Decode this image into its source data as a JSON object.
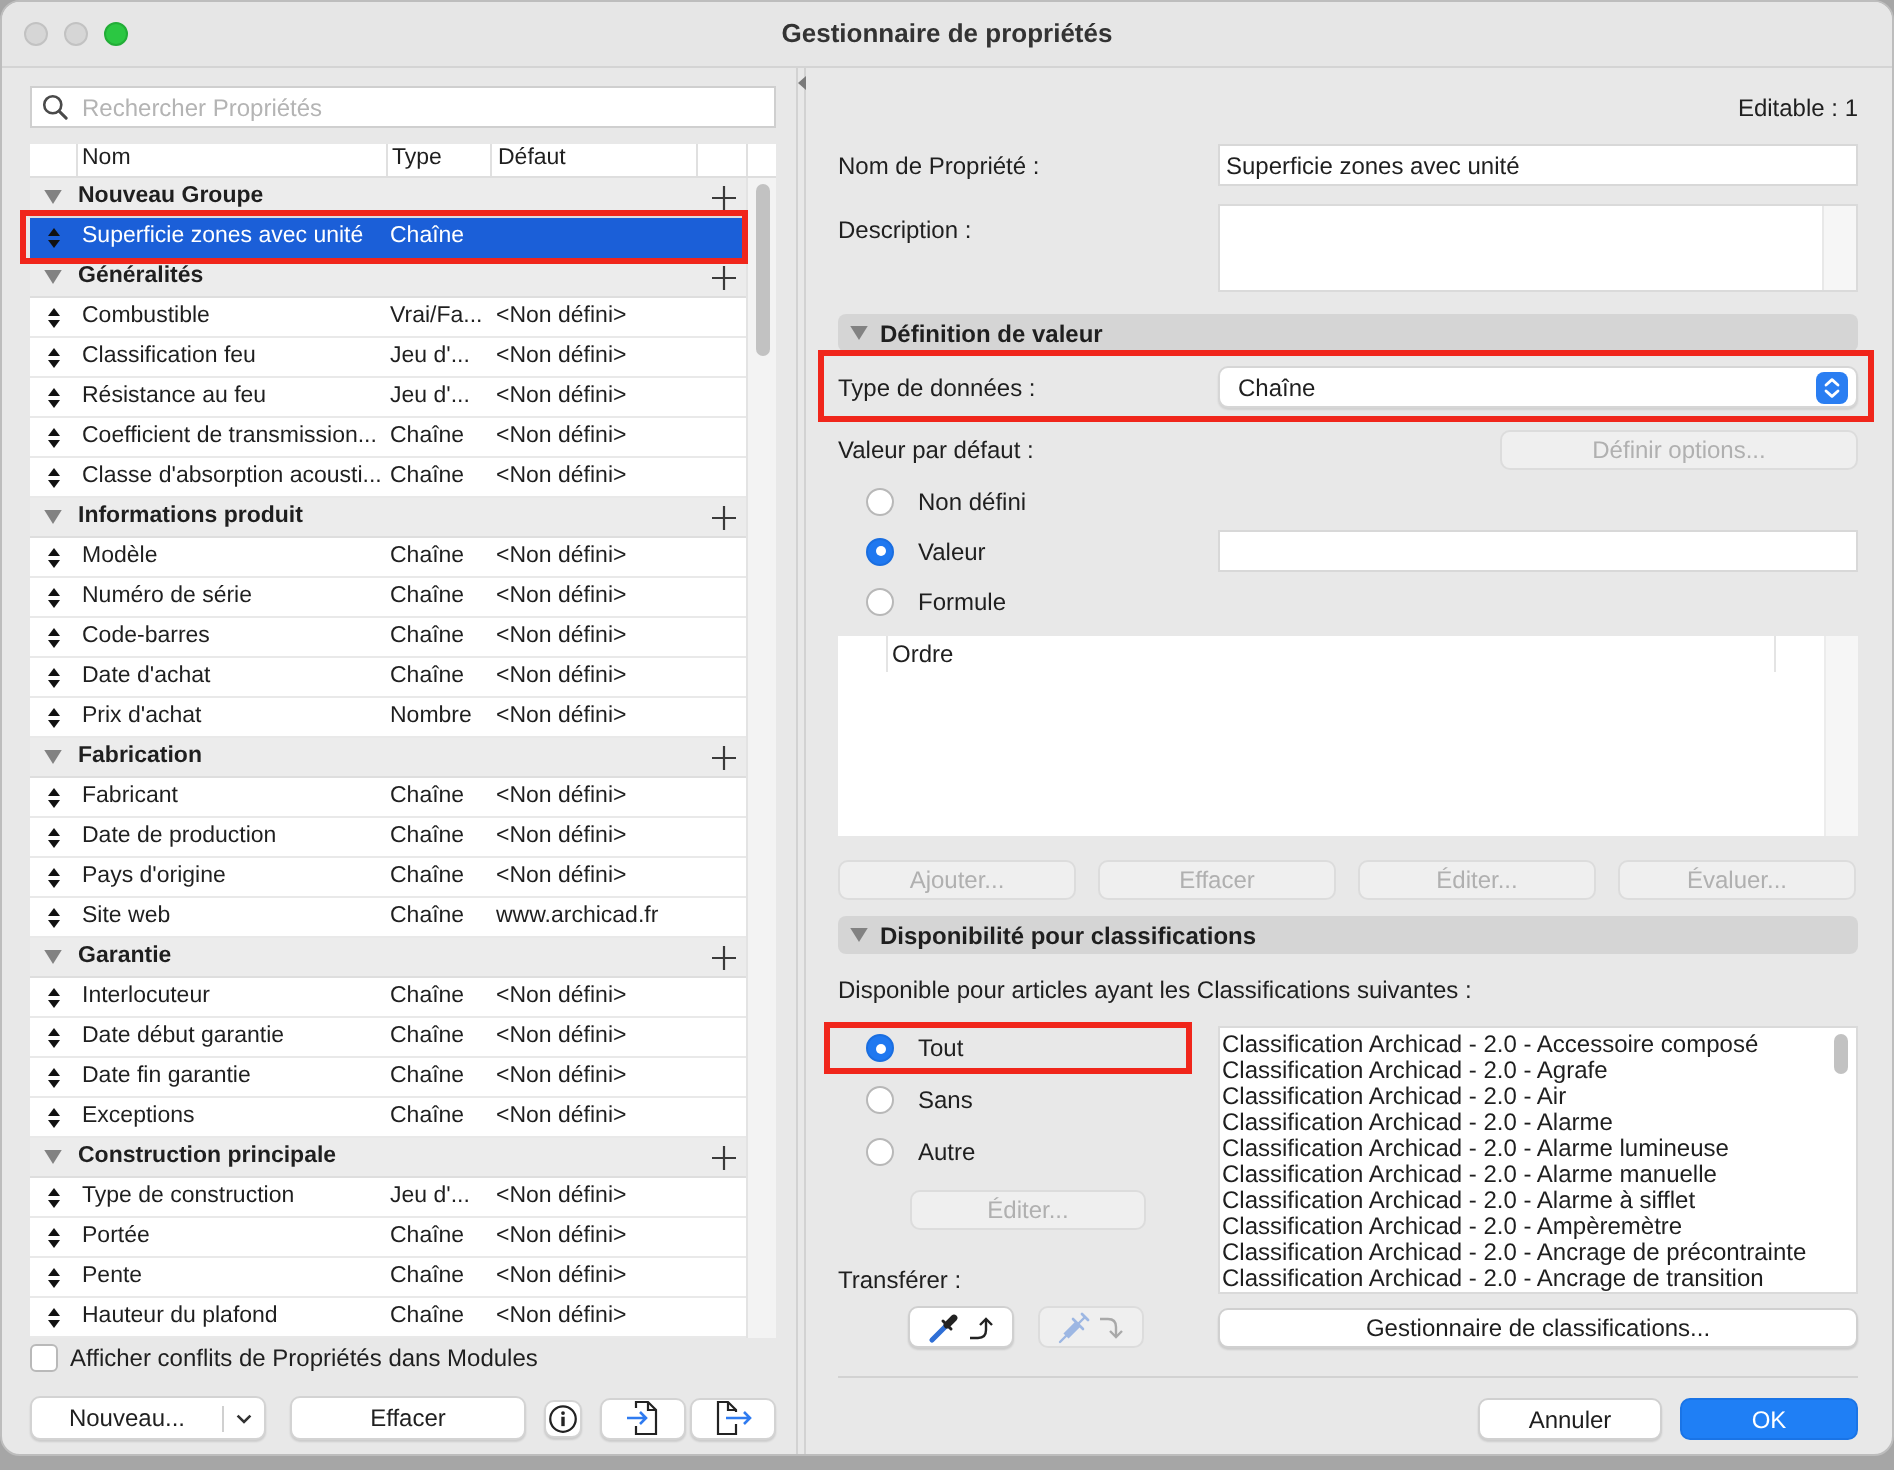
{
  "window": {
    "title": "Gestionnaire de propriétés"
  },
  "search": {
    "placeholder": "Rechercher Propriétés"
  },
  "table": {
    "columns": [
      "Nom",
      "Type",
      "Défaut"
    ],
    "groups": [
      {
        "name": "Nouveau Groupe",
        "expanded": true,
        "rows": [
          {
            "name": "Superficie zones avec unité",
            "type": "Chaîne",
            "selected": true,
            "highlighted": true
          }
        ]
      },
      {
        "name": "Généralités",
        "expanded": true,
        "rows": [
          {
            "name": "Combustible",
            "type": "Vrai/Fa...",
            "default": "<Non défini>",
            "selected": false,
            "highlighted": false
          },
          {
            "name": "Classification feu",
            "type": "Jeu d'...",
            "default": "<Non défini>",
            "selected": false,
            "highlighted": false
          },
          {
            "name": "Résistance au feu",
            "type": "Jeu d'...",
            "default": "<Non défini>",
            "selected": false,
            "highlighted": false
          },
          {
            "name": "Coefficient de transmission...",
            "type": "Chaîne",
            "default": "<Non défini>",
            "selected": false,
            "highlighted": false
          },
          {
            "name": "Classe d'absorption acousti...",
            "type": "Chaîne",
            "default": "<Non défini>",
            "selected": false,
            "highlighted": false
          }
        ]
      },
      {
        "name": "Informations produit",
        "expanded": true,
        "rows": [
          {
            "name": "Modèle",
            "type": "Chaîne",
            "default": "<Non défini>",
            "selected": false,
            "highlighted": false
          },
          {
            "name": "Numéro de série",
            "type": "Chaîne",
            "default": "<Non défini>",
            "selected": false,
            "highlighted": false
          },
          {
            "name": "Code-barres",
            "type": "Chaîne",
            "default": "<Non défini>",
            "selected": false,
            "highlighted": false
          },
          {
            "name": "Date d'achat",
            "type": "Chaîne",
            "default": "<Non défini>",
            "selected": false,
            "highlighted": false
          },
          {
            "name": "Prix d'achat",
            "type": "Nombre",
            "default": "<Non défini>",
            "selected": false,
            "highlighted": false
          }
        ]
      },
      {
        "name": "Fabrication",
        "expanded": true,
        "rows": [
          {
            "name": "Fabricant",
            "type": "Chaîne",
            "default": "<Non défini>",
            "selected": false,
            "highlighted": false
          },
          {
            "name": "Date de production",
            "type": "Chaîne",
            "default": "<Non défini>",
            "selected": false,
            "highlighted": false
          },
          {
            "name": "Pays d'origine",
            "type": "Chaîne",
            "default": "<Non défini>",
            "selected": false,
            "highlighted": false
          },
          {
            "name": "Site web",
            "type": "Chaîne",
            "default": "www.archicad.fr",
            "selected": false,
            "highlighted": false
          }
        ]
      },
      {
        "name": "Garantie",
        "expanded": true,
        "rows": [
          {
            "name": "Interlocuteur",
            "type": "Chaîne",
            "default": "<Non défini>",
            "selected": false,
            "highlighted": false
          },
          {
            "name": "Date début garantie",
            "type": "Chaîne",
            "default": "<Non défini>",
            "selected": false,
            "highlighted": false
          },
          {
            "name": "Date fin garantie",
            "type": "Chaîne",
            "default": "<Non défini>",
            "selected": false,
            "highlighted": false
          },
          {
            "name": "Exceptions",
            "type": "Chaîne",
            "default": "<Non défini>",
            "selected": false,
            "highlighted": false
          }
        ]
      },
      {
        "name": "Construction principale",
        "expanded": true,
        "rows": [
          {
            "name": "Type de construction",
            "type": "Jeu d'...",
            "default": "<Non défini>",
            "selected": false,
            "highlighted": false
          },
          {
            "name": "Portée",
            "type": "Chaîne",
            "default": "<Non défini>",
            "selected": false,
            "highlighted": false
          },
          {
            "name": "Pente",
            "type": "Chaîne",
            "default": "<Non défini>",
            "selected": false,
            "highlighted": false
          },
          {
            "name": "Hauteur du plafond",
            "type": "Chaîne",
            "default": "<Non défini>",
            "selected": false,
            "highlighted": false
          }
        ]
      }
    ]
  },
  "left_footer": {
    "conflicts_checkbox": {
      "label": "Afficher conflits de Propriétés dans Modules",
      "checked": false
    },
    "buttons": [
      {
        "kind": "split",
        "label": "Nouveau..."
      },
      {
        "kind": "text",
        "label": "Effacer"
      },
      {
        "kind": "info"
      },
      {
        "kind": "import"
      },
      {
        "kind": "export"
      }
    ]
  },
  "detail": {
    "editable": "Editable : 1",
    "property_name": {
      "label": "Nom de Propriété :",
      "value": "Superficie zones avec unité"
    },
    "description": {
      "label": "Description :"
    },
    "value_definition": {
      "title": "Définition de valeur",
      "expanded": true,
      "data_type": {
        "label": "Type de données :",
        "value": "Chaîne",
        "highlighted": true
      },
      "default_value": {
        "label": "Valeur par défaut :",
        "options_button": {
          "label": "Définir options...",
          "disabled": true
        },
        "options": [
          {
            "kind": "plain",
            "label": "Non défini",
            "selected": false
          },
          {
            "kind": "field",
            "label": "Valeur",
            "selected": true
          },
          {
            "kind": "plain",
            "label": "Formule",
            "selected": false
          }
        ]
      },
      "list": {
        "columns": [
          "Ordre"
        ]
      },
      "buttons": [
        {
          "label": "Ajouter...",
          "disabled": true
        },
        {
          "label": "Effacer",
          "disabled": true
        },
        {
          "label": "Éditer...",
          "disabled": true
        },
        {
          "label": "Évaluer...",
          "disabled": true
        }
      ]
    },
    "classification_availability": {
      "title": "Disponibilité pour classifications",
      "expanded": true,
      "caption": "Disponible pour articles ayant les Classifications suivantes :",
      "options": [
        {
          "label": "Tout",
          "selected": true,
          "highlighted": true
        },
        {
          "label": "Sans",
          "selected": false,
          "highlighted": false
        },
        {
          "label": "Autre",
          "selected": false,
          "highlighted": false
        }
      ],
      "edit_button": {
        "label": "Éditer...",
        "disabled": true
      },
      "transfer": {
        "label": "Transférer :",
        "buttons": [
          {
            "kind": "pick",
            "disabled": false
          },
          {
            "kind": "inject",
            "disabled": true
          }
        ]
      },
      "classifications": [
        "Classification Archicad - 2.0 - Accessoire composé",
        "Classification Archicad - 2.0 - Agrafe",
        "Classification Archicad - 2.0 - Air",
        "Classification Archicad - 2.0 - Alarme",
        "Classification Archicad - 2.0 - Alarme lumineuse",
        "Classification Archicad - 2.0 - Alarme manuelle",
        "Classification Archicad - 2.0 - Alarme à sifflet",
        "Classification Archicad - 2.0 - Ampèremètre",
        "Classification Archicad - 2.0 - Ancrage de précontrainte",
        "Classification Archicad - 2.0 - Ancrage de transition"
      ],
      "manager_button": {
        "label": "Gestionnaire de classifications...",
        "disabled": false
      }
    }
  },
  "dialog_buttons": [
    {
      "label": "Annuler",
      "default": false
    },
    {
      "label": "OK",
      "default": true
    }
  ]
}
